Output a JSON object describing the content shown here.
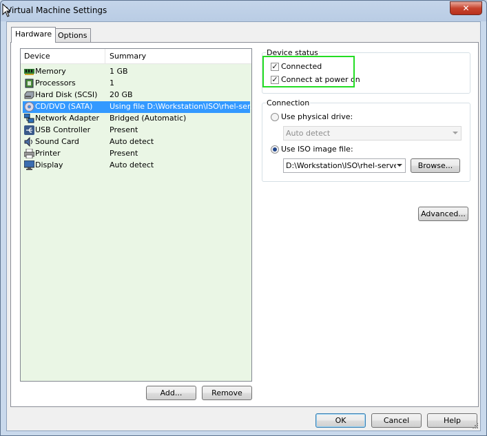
{
  "window": {
    "title": "Virtual Machine Settings",
    "close_label": "✕"
  },
  "tabs": [
    {
      "label": "Hardware"
    },
    {
      "label": "Options"
    }
  ],
  "device_list": {
    "headers": {
      "device": "Device",
      "summary": "Summary"
    },
    "rows": [
      {
        "name": "Memory",
        "summary": "1 GB",
        "icon": "memory-icon"
      },
      {
        "name": "Processors",
        "summary": "1",
        "icon": "processor-icon"
      },
      {
        "name": "Hard Disk (SCSI)",
        "summary": "20 GB",
        "icon": "hard-disk-icon"
      },
      {
        "name": "CD/DVD (SATA)",
        "summary": "Using file D:\\Workstation\\ISO\\rhel-ser...",
        "icon": "cd-dvd-icon",
        "selected": true
      },
      {
        "name": "Network Adapter",
        "summary": "Bridged (Automatic)",
        "icon": "network-adapter-icon"
      },
      {
        "name": "USB Controller",
        "summary": "Present",
        "icon": "usb-icon"
      },
      {
        "name": "Sound Card",
        "summary": "Auto detect",
        "icon": "sound-card-icon"
      },
      {
        "name": "Printer",
        "summary": "Present",
        "icon": "printer-icon"
      },
      {
        "name": "Display",
        "summary": "Auto detect",
        "icon": "display-icon"
      }
    ]
  },
  "list_buttons": {
    "add": "Add...",
    "remove": "Remove"
  },
  "device_status": {
    "label": "Device status",
    "connected": {
      "label": "Connected",
      "checked": true
    },
    "connect_at_power_on": {
      "label": "Connect at power on",
      "checked": true
    }
  },
  "connection": {
    "label": "Connection",
    "physical_drive": {
      "label": "Use physical drive:",
      "selected": false,
      "combo_value": "Auto detect"
    },
    "iso_image": {
      "label": "Use ISO image file:",
      "selected": true,
      "path": "D:\\Workstation\\ISO\\rhel-server",
      "browse_label": "Browse..."
    }
  },
  "advanced_label": "Advanced...",
  "footer": {
    "ok": "OK",
    "cancel": "Cancel",
    "help": "Help"
  },
  "colors": {
    "selection": "#3399ff",
    "list_background": "#eaf6e5",
    "highlight_box": "#22dd22"
  }
}
